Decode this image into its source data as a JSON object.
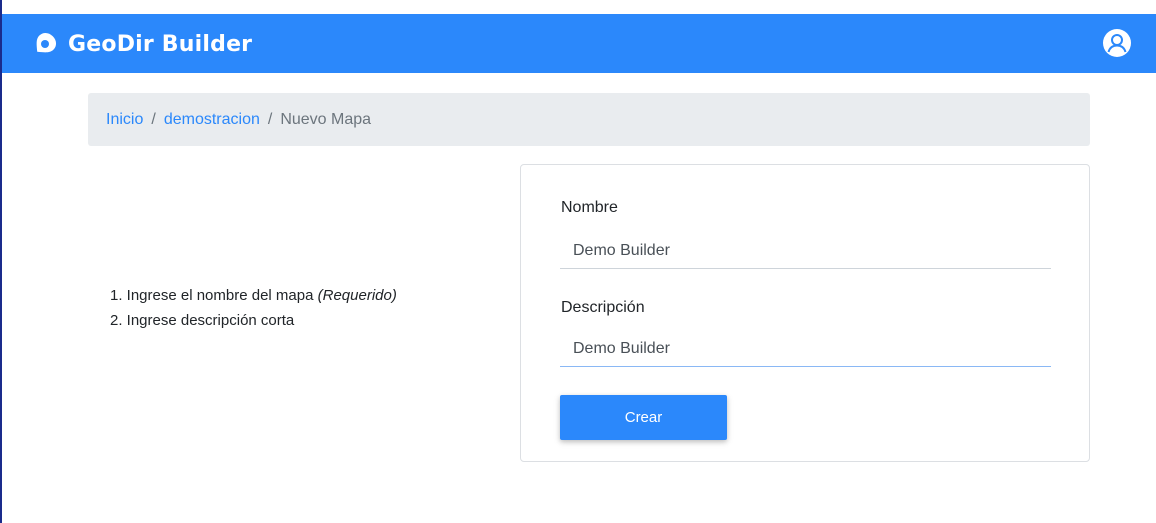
{
  "app": {
    "brand_name": "GeoDir Builder",
    "brand_icon": "map-pin-icon",
    "avatar_icon": "user-avatar-icon"
  },
  "breadcrumb": {
    "items": [
      {
        "label": "Inicio",
        "link": true
      },
      {
        "label": "demostracion",
        "link": true
      },
      {
        "label": "Nuevo Mapa",
        "link": false
      }
    ],
    "separator": "/"
  },
  "instructions": {
    "step1_prefix": "1. Ingrese el nombre del mapa ",
    "step1_note": "(Requerido)",
    "step2": "2. Ingrese descripción corta"
  },
  "form": {
    "name_label": "Nombre",
    "name_value": "Demo Builder",
    "description_label": "Descripción",
    "description_value": "Demo Builder",
    "submit_label": "Crear"
  },
  "colors": {
    "primary": "#2b88fb",
    "breadcrumb_bg": "#e9ecef",
    "text_muted": "#6c757d"
  }
}
